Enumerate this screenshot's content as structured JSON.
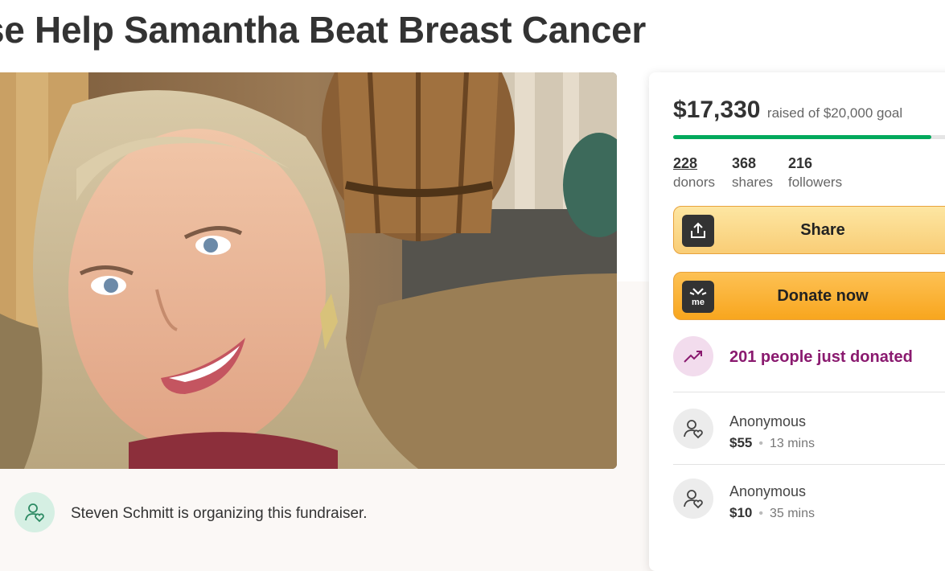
{
  "campaign": {
    "title": "se Help Samantha Beat Breast Cancer",
    "photo_alt": "woman-smiling-photo"
  },
  "organizer": {
    "text": "Steven Schmitt is organizing this fundraiser."
  },
  "progress": {
    "amount": "$17,330",
    "goal_text": "raised of $20,000 goal",
    "fraction": 0.8665,
    "color": "#02a95c"
  },
  "stats": [
    {
      "num": "228",
      "label": "donors"
    },
    {
      "num": "368",
      "label": "shares"
    },
    {
      "num": "216",
      "label": "followers"
    }
  ],
  "buttons": {
    "share_label": "Share",
    "donate_label": "Donate now",
    "donate_icon_text": "me"
  },
  "recent": {
    "text": "201 people just donated",
    "color": "#8a1a6f"
  },
  "donations": [
    {
      "name": "Anonymous",
      "amount": "$55",
      "time": "13 mins"
    },
    {
      "name": "Anonymous",
      "amount": "$10",
      "time": "35 mins"
    }
  ]
}
